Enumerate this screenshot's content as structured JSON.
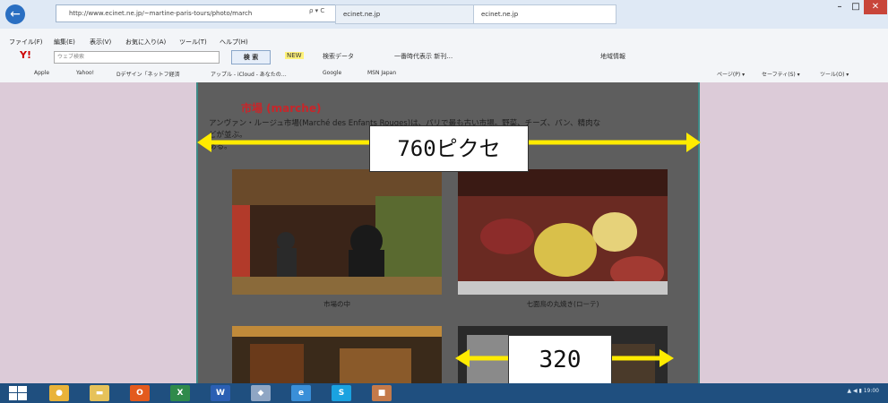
{
  "browser": {
    "back_glyph": "←",
    "address": "http://www.ecinet.ne.jp/~martine-paris-tours/photo/march",
    "address_controls": "ρ ▾ C",
    "tabs": [
      {
        "label": "ecinet.ne.jp"
      },
      {
        "label": "ecinet.ne.jp"
      }
    ],
    "window_controls": [
      "–",
      "□",
      "✕"
    ],
    "menu": [
      "ファイル(F)",
      "編集(E)",
      "表示(V)",
      "お気に入り(A)",
      "ツール(T)",
      "ヘルプ(H)"
    ],
    "toolbar": {
      "yahoo": "Y!",
      "search_placeholder": "ウェブ検索",
      "search_button": "検 索",
      "items": [
        "NEW",
        "検索データ",
        "一番時代表示 新刊…",
        "地域情報"
      ]
    },
    "favorites": [
      "Apple",
      "Yahoo!",
      "Dデザイン「ネットフ経済",
      "アップル - iCloud - あなたの…",
      "Google",
      "MSN Japan"
    ],
    "right_tools": [
      "ページ(P) ▾",
      "セーフティ(S) ▾",
      "ツール(O) ▾"
    ]
  },
  "page": {
    "heading": "市場 (marche)",
    "intro_line1": "アンヴァン・ルージュ市場(Marché des Enfants Rouges)は、パリで最も古い市場。野菜、チーズ、パン、精肉な",
    "intro_line2": "どが並ぶ。",
    "intro_line3": "ある。",
    "photos": [
      {
        "caption": "市場の中",
        "colors": [
          "#3a2418",
          "#b23a2a",
          "#5a6a30"
        ]
      },
      {
        "caption": "七面鳥の丸焼き(ローテ)",
        "colors": [
          "#6a2a22",
          "#d9c04a",
          "#8c2c2a"
        ]
      },
      {
        "caption": "",
        "colors": [
          "#3a2a1a",
          "#c08a3a",
          "#6a3a1a"
        ]
      },
      {
        "caption": "",
        "colors": [
          "#2a2a2a",
          "#8a8a8a",
          "#4a3a2a"
        ]
      }
    ]
  },
  "annotations": {
    "width_label": "760ピクセ",
    "image_width_label": "320",
    "arrow_color": "#ffeb00"
  },
  "taskbar": {
    "apps": [
      {
        "name": "chrome-icon",
        "glyph": "●",
        "color": "#e9b33a"
      },
      {
        "name": "folder-icon",
        "glyph": "▬",
        "color": "#e6c25a"
      },
      {
        "name": "office-icon",
        "glyph": "O",
        "color": "#e35a1d"
      },
      {
        "name": "excel-icon",
        "glyph": "X",
        "color": "#2f8a4b"
      },
      {
        "name": "word-icon",
        "glyph": "W",
        "color": "#2b5fb3"
      },
      {
        "name": "paint-icon",
        "glyph": "◆",
        "color": "#8fa6c4"
      },
      {
        "name": "ie-icon",
        "glyph": "e",
        "color": "#3a8fd8"
      },
      {
        "name": "skype-icon",
        "glyph": "S",
        "color": "#1aa2e0"
      },
      {
        "name": "app-icon",
        "glyph": "■",
        "color": "#c47a4a"
      }
    ],
    "tray": "▲ ◀ ▮ 19:00"
  }
}
